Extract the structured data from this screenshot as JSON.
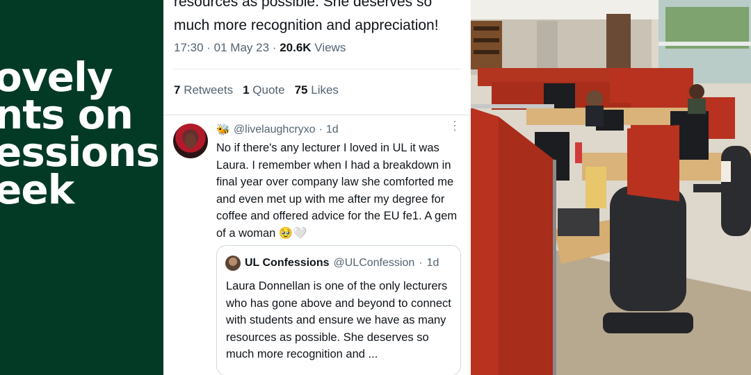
{
  "left_panel": {
    "headline_lines": [
      "ovely",
      "nts on",
      "essions",
      "eek"
    ],
    "bg_color": "#023a26"
  },
  "main_tweet": {
    "text_fragment": "resources as possible. She deserves so much more recognition and appreciation!",
    "time": "17:30",
    "date": "01 May 23",
    "views_count": "20.6K",
    "views_label": "Views",
    "retweets_count": "7",
    "retweets_label": "Retweets",
    "quotes_count": "1",
    "quotes_label": "Quote",
    "likes_count": "75",
    "likes_label": "Likes"
  },
  "reply": {
    "handle": "@livelaughcryxo",
    "age": "1d",
    "text": "No if there's any lecturer I loved in UL it was Laura. I remember when I had a breakdown in final year over company law she comforted me and even met up with me after my degree for coffee and offered advice for the EU fe1. A gem of a woman",
    "emoji": "🥹🤍",
    "bee_icon": "🐝"
  },
  "quoted": {
    "name": "UL Confessions",
    "handle": "@ULConfession",
    "age": "1d",
    "text": "Laura Donnellan is one of the only lecturers who has gone above and beyond to connect with students and ensure we have as many resources as possible. She deserves so much more recognition and ..."
  },
  "colors": {
    "accent_text": "#0f1419",
    "muted_text": "#536471",
    "cubicle_red": "#b8321f"
  }
}
